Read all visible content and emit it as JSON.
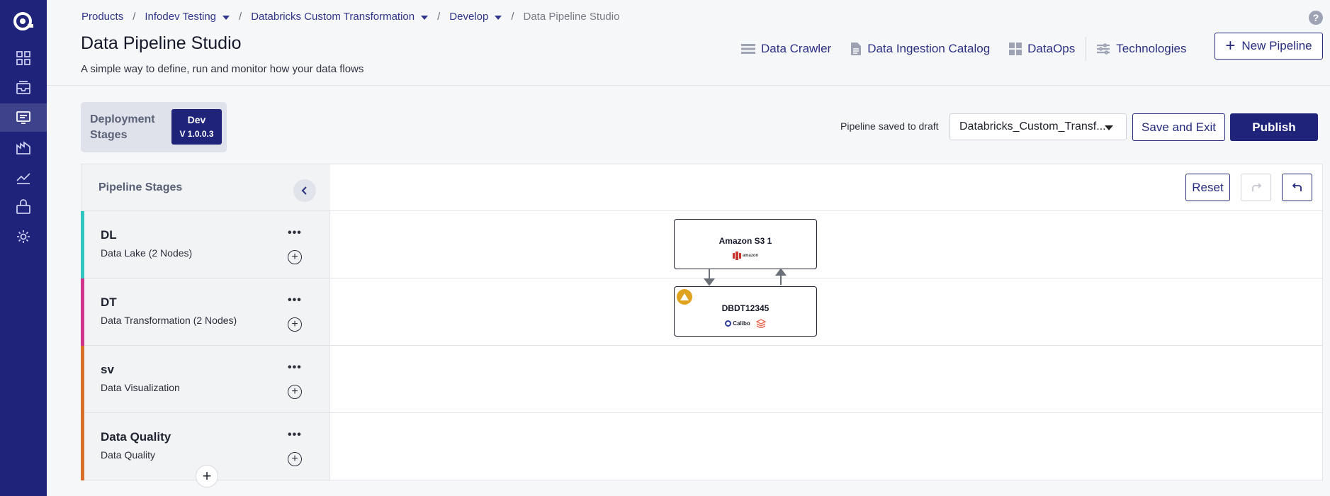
{
  "breadcrumb": {
    "items": [
      {
        "label": "Products",
        "dropdown": false
      },
      {
        "label": "Infodev Testing",
        "dropdown": true
      },
      {
        "label": "Databricks Custom Transformation",
        "dropdown": true
      },
      {
        "label": "Develop",
        "dropdown": true
      }
    ],
    "current": "Data Pipeline Studio",
    "separator": "/"
  },
  "header": {
    "title": "Data Pipeline Studio",
    "subtitle": "A simple way to define, run and monitor how your data flows",
    "help_label": "?"
  },
  "top_links": {
    "data_crawler": "Data Crawler",
    "data_ingestion_catalog": "Data Ingestion Catalog",
    "dataops": "DataOps",
    "technologies": "Technologies",
    "new_pipeline": "New Pipeline"
  },
  "deployment": {
    "label": "Deployment Stages",
    "env_name": "Dev",
    "env_version": "V 1.0.0.3"
  },
  "toolbar": {
    "status_text": "Pipeline saved to draft",
    "pipeline_select_value": "Databricks_Custom_Transf...",
    "save_exit_label": "Save and Exit",
    "publish_label": "Publish",
    "reset_label": "Reset"
  },
  "stages_panel": {
    "title": "Pipeline Stages",
    "more_label": "•••",
    "add_label": "+",
    "stages": [
      {
        "name": "DL",
        "description": "Data Lake (2 Nodes)",
        "color": "#2ec4c0"
      },
      {
        "name": "DT",
        "description": "Data Transformation (2 Nodes)",
        "color": "#d0338a"
      },
      {
        "name": "sv",
        "description": "Data Visualization",
        "color": "#d96d2a"
      },
      {
        "name": "Data Quality",
        "description": "Data Quality",
        "color": "#d96d2a"
      }
    ]
  },
  "canvas": {
    "nodes": [
      {
        "title": "Amazon S3 1",
        "icons": [
          "amazon-s3-icon"
        ],
        "warning": false
      },
      {
        "title": "DBDT12345",
        "icons": [
          "calibo-icon",
          "databricks-icon"
        ],
        "warning": true,
        "brand_text": "Calibo"
      }
    ],
    "aws_text": "amazon"
  },
  "colors": {
    "rail": "#1f2379",
    "accent": "#262b7d",
    "warning": "#e0a320"
  },
  "rail_icons": [
    "calibo-logo-icon",
    "dashboard-icon",
    "inbox-icon",
    "pipeline-studio-icon",
    "data-icon",
    "chart-line-icon",
    "bag-icon",
    "settings-icon"
  ]
}
